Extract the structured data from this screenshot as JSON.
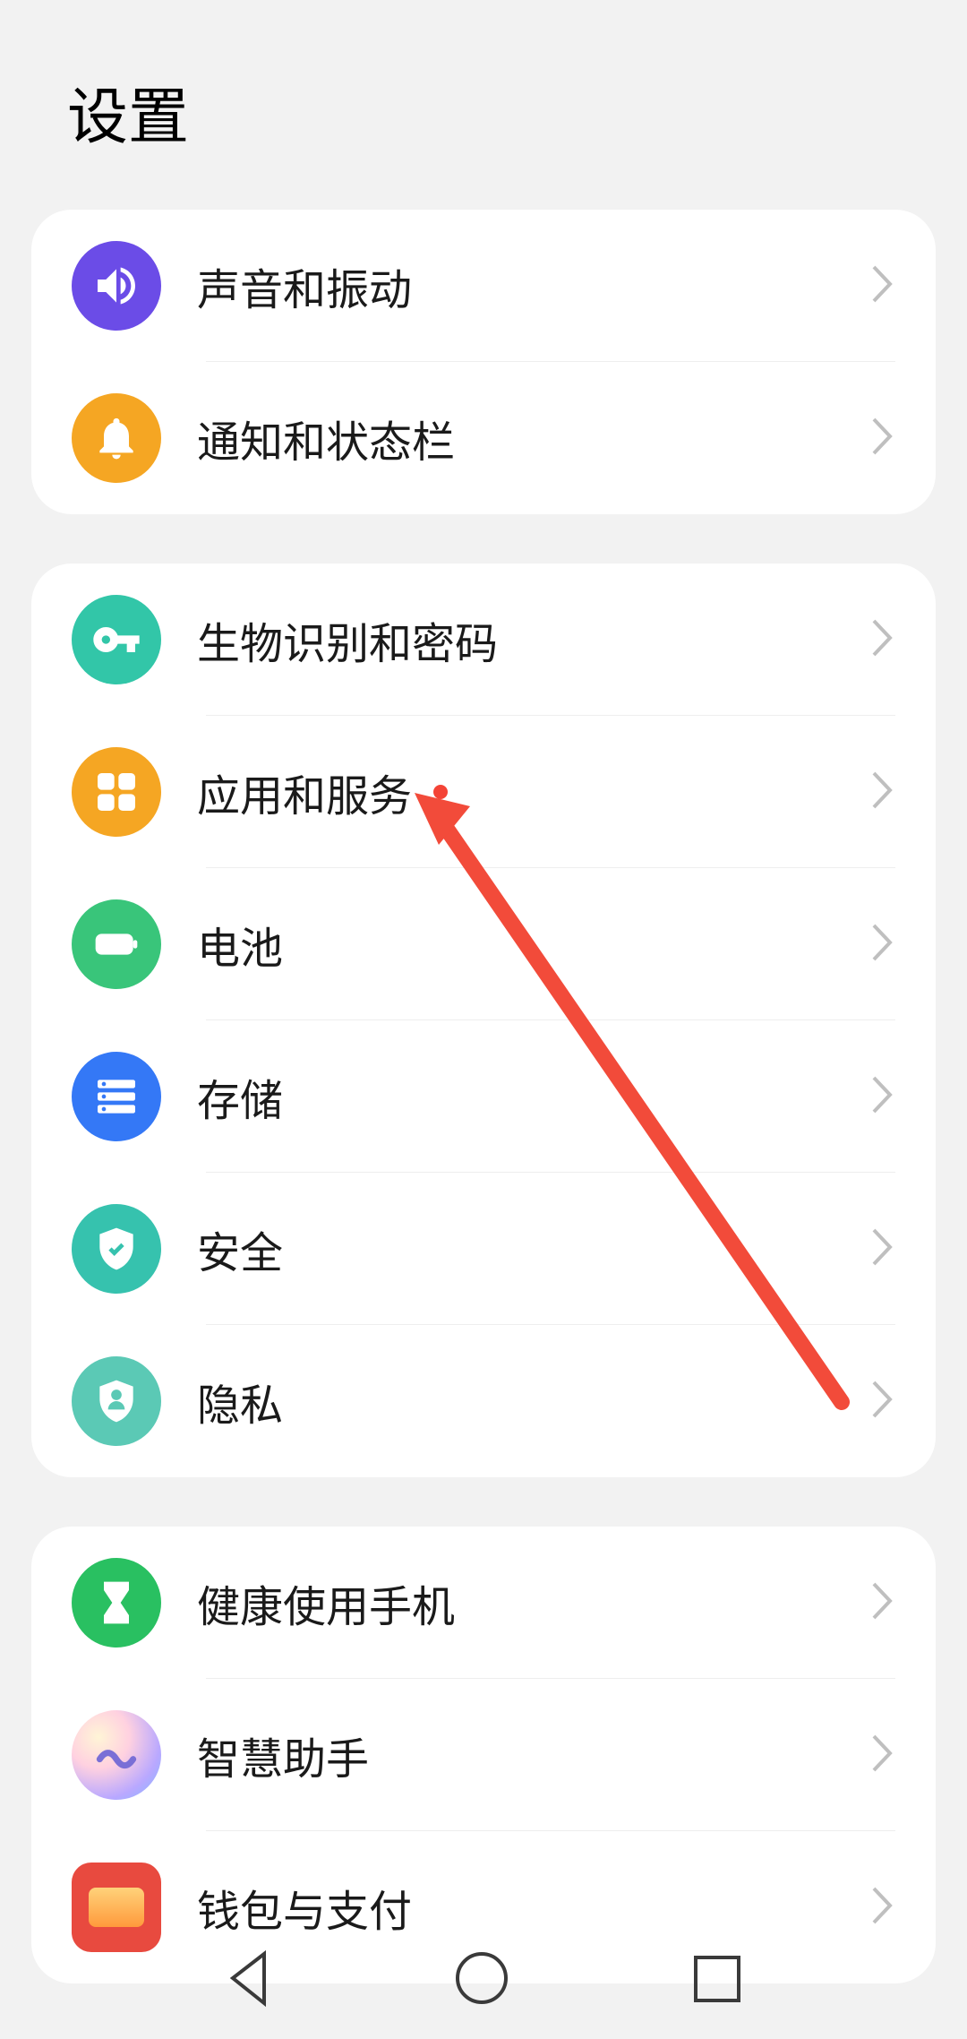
{
  "pageTitle": "设置",
  "groups": [
    {
      "id": "media",
      "items": [
        {
          "id": "sound-vibration",
          "label": "声音和振动",
          "icon": "volume",
          "color": "purple",
          "dot": false
        },
        {
          "id": "notifications-statusbar",
          "label": "通知和状态栏",
          "icon": "bell",
          "color": "orange",
          "dot": false
        }
      ]
    },
    {
      "id": "security-apps",
      "items": [
        {
          "id": "biometrics-password",
          "label": "生物识别和密码",
          "icon": "key",
          "color": "teal-light",
          "dot": false
        },
        {
          "id": "apps-services",
          "label": "应用和服务",
          "icon": "grid",
          "color": "orange2",
          "dot": true
        },
        {
          "id": "battery",
          "label": "电池",
          "icon": "battery",
          "color": "green",
          "dot": false
        },
        {
          "id": "storage",
          "label": "存储",
          "icon": "storage",
          "color": "blue",
          "dot": false
        },
        {
          "id": "security",
          "label": "安全",
          "icon": "shield",
          "color": "teal",
          "dot": false
        },
        {
          "id": "privacy",
          "label": "隐私",
          "icon": "privacy",
          "color": "teal2",
          "dot": false
        }
      ]
    },
    {
      "id": "assistant-payment",
      "items": [
        {
          "id": "digital-wellbeing",
          "label": "健康使用手机",
          "icon": "hourglass",
          "color": "green2",
          "dot": false
        },
        {
          "id": "smart-assistant",
          "label": "智慧助手",
          "icon": "assistant",
          "color": "gradient",
          "dot": false
        },
        {
          "id": "wallet-payment",
          "label": "钱包与支付",
          "icon": "wallet",
          "color": "red",
          "dot": false
        }
      ]
    }
  ],
  "annotation": {
    "type": "arrow",
    "target": "apps-services"
  }
}
